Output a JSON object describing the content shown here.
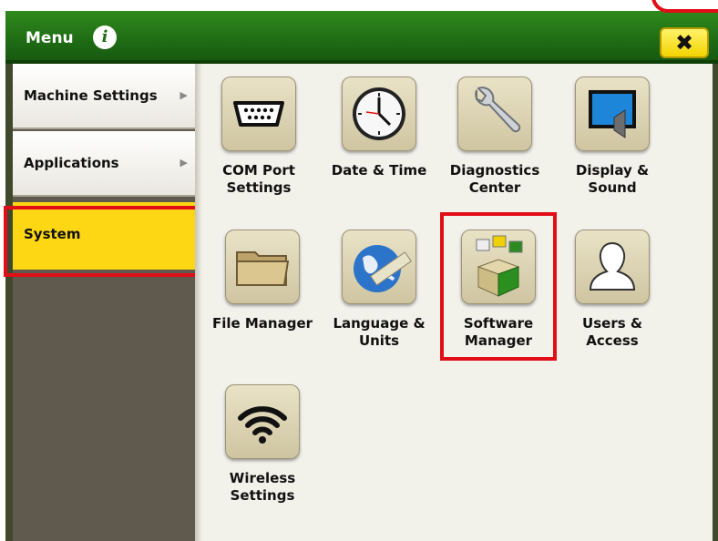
{
  "header": {
    "title": "Menu",
    "info_icon": "info-icon",
    "close_icon": "close-icon",
    "close_glyph": "✖"
  },
  "sidebar": {
    "items": [
      {
        "label": "Machine Settings",
        "chevron": "▶"
      },
      {
        "label": "Applications",
        "chevron": "▶"
      },
      {
        "label": "System"
      }
    ]
  },
  "tiles": [
    {
      "label_line1": "COM Port",
      "label_line2": "Settings",
      "icon": "serial-port-icon"
    },
    {
      "label_line1": "Date & Time",
      "label_line2": "",
      "icon": "clock-icon"
    },
    {
      "label_line1": "Diagnostics",
      "label_line2": "Center",
      "icon": "wrench-icon"
    },
    {
      "label_line1": "Display &",
      "label_line2": "Sound",
      "icon": "display-sound-icon"
    },
    {
      "label_line1": "File Manager",
      "label_line2": "",
      "icon": "folder-icon"
    },
    {
      "label_line1": "Language &",
      "label_line2": "Units",
      "icon": "globe-ruler-icon"
    },
    {
      "label_line1": "Software",
      "label_line2": "Manager",
      "icon": "software-box-icon"
    },
    {
      "label_line1": "Users &",
      "label_line2": "Access",
      "icon": "user-silhouette-icon"
    },
    {
      "label_line1": "Wireless",
      "label_line2": "Settings",
      "icon": "wifi-icon"
    }
  ],
  "colors": {
    "header_green": "#1f6c14",
    "selected_yellow": "#fdd714",
    "highlight_red": "#e10d17",
    "content_bg": "#f2f1ea",
    "sidebar_bg": "#5f5a4d"
  }
}
